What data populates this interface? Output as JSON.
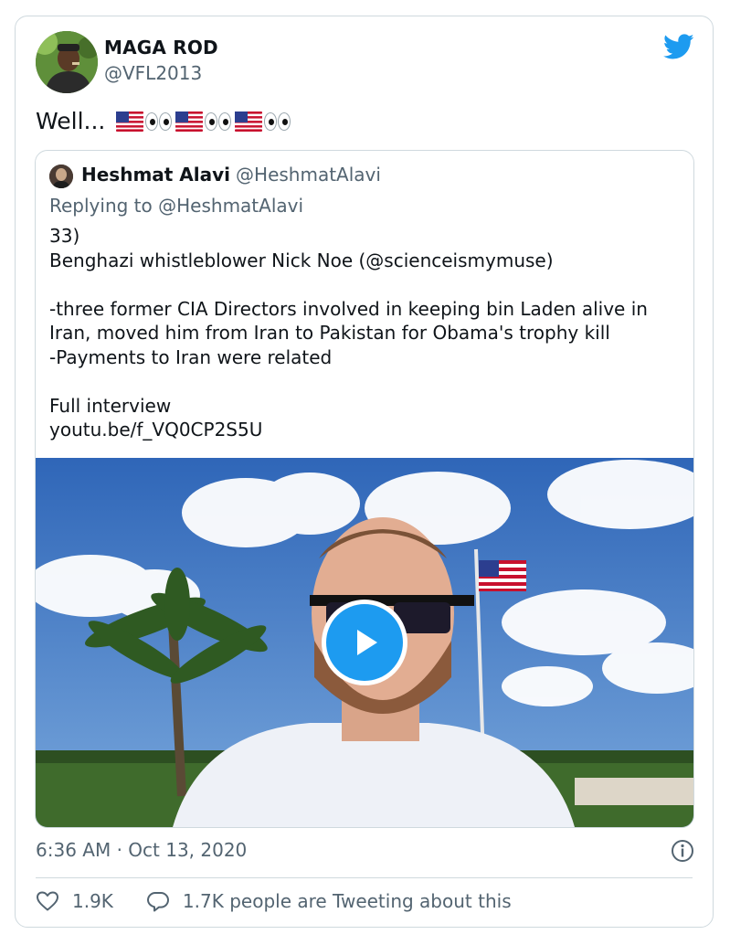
{
  "author": {
    "name": "MAGA ROD",
    "handle": "@VFL2013"
  },
  "tweet": {
    "text": "Well..."
  },
  "quoted": {
    "name": "Heshmat Alavi",
    "handle": "@HeshmatAlavi",
    "reply_prefix": "Replying to",
    "reply_to": "@HeshmatAlavi",
    "body": "33)\nBenghazi whistleblower Nick Noe (@scienceismymuse)\n\n-three former CIA Directors involved in keeping bin Laden alive in Iran, moved him from Iran to Pakistan for Obama's trophy kill\n-Payments to Iran were related\n\nFull interview\nyoutu.be/f_VQ0CP2S5U"
  },
  "timestamp": "6:36 AM · Oct 13, 2020",
  "stats": {
    "likes": "1.9K",
    "tweeting": "1.7K people are Tweeting about this"
  },
  "colors": {
    "accent": "#1d9bf0",
    "muted": "#536471",
    "border": "#cfd9de"
  },
  "icons": [
    "twitter-bird-icon",
    "us-flag-icon",
    "eyes-icon",
    "play-icon",
    "info-icon",
    "heart-icon",
    "reply-bubble-icon"
  ]
}
